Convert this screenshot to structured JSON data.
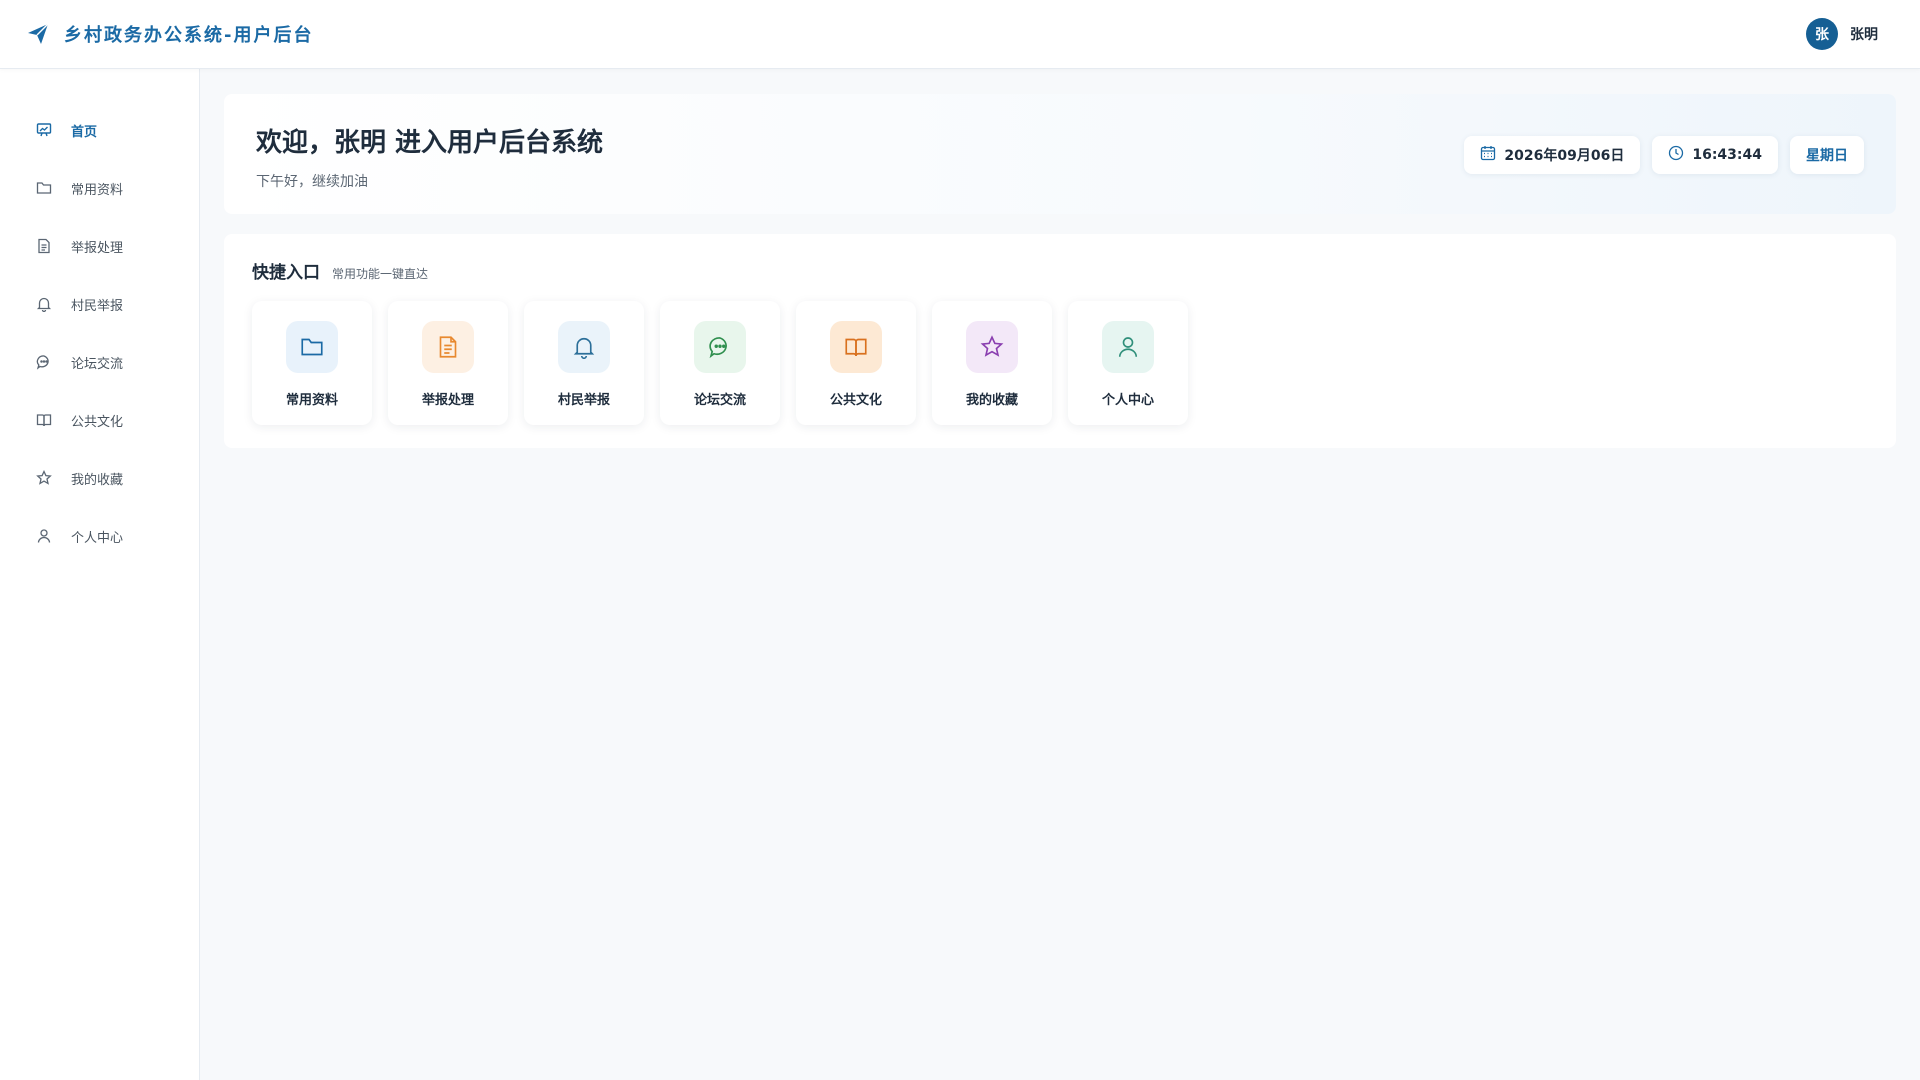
{
  "app": {
    "title": "乡村政务办公系统-用户后台"
  },
  "user": {
    "avatar_text": "张",
    "name": "张明"
  },
  "sidebar": {
    "items": [
      {
        "label": "首页",
        "icon": "presentation-chart-icon",
        "active": true
      },
      {
        "label": "常用资料",
        "icon": "folder-icon"
      },
      {
        "label": "举报处理",
        "icon": "document-icon"
      },
      {
        "label": "村民举报",
        "icon": "bell-icon"
      },
      {
        "label": "论坛交流",
        "icon": "chat-bubble-icon"
      },
      {
        "label": "公共文化",
        "icon": "book-icon"
      },
      {
        "label": "我的收藏",
        "icon": "star-icon"
      },
      {
        "label": "个人中心",
        "icon": "user-icon"
      }
    ]
  },
  "welcome": {
    "title": "欢迎，张明 进入用户后台系统",
    "subtitle": "下午好，继续加油",
    "date": "2026年09月06日",
    "time": "16:43:44",
    "weekday": "星期日"
  },
  "quick": {
    "title": "快捷入口",
    "subtitle": "常用功能一键直达",
    "tiles": [
      {
        "label": "常用资料",
        "icon": "folder-icon",
        "color": "#1b6aa5",
        "bg": "#e8f2fb"
      },
      {
        "label": "举报处理",
        "icon": "document-icon",
        "color": "#e8892f",
        "bg": "#fdf0e3"
      },
      {
        "label": "村民举报",
        "icon": "bell-icon",
        "color": "#2c6f99",
        "bg": "#eaf3fa"
      },
      {
        "label": "论坛交流",
        "icon": "chat-bubble-icon",
        "color": "#2f8f4e",
        "bg": "#e8f6ec"
      },
      {
        "label": "公共文化",
        "icon": "book-icon",
        "color": "#d9711f",
        "bg": "#fde9d4"
      },
      {
        "label": "我的收藏",
        "icon": "star-icon",
        "color": "#8a3fb0",
        "bg": "#f3e8f8"
      },
      {
        "label": "个人中心",
        "icon": "user-icon",
        "color": "#2f8f7a",
        "bg": "#e6f5f1"
      }
    ]
  },
  "colors": {
    "primary": "#1b6aa5",
    "avatar": "#155f94"
  }
}
